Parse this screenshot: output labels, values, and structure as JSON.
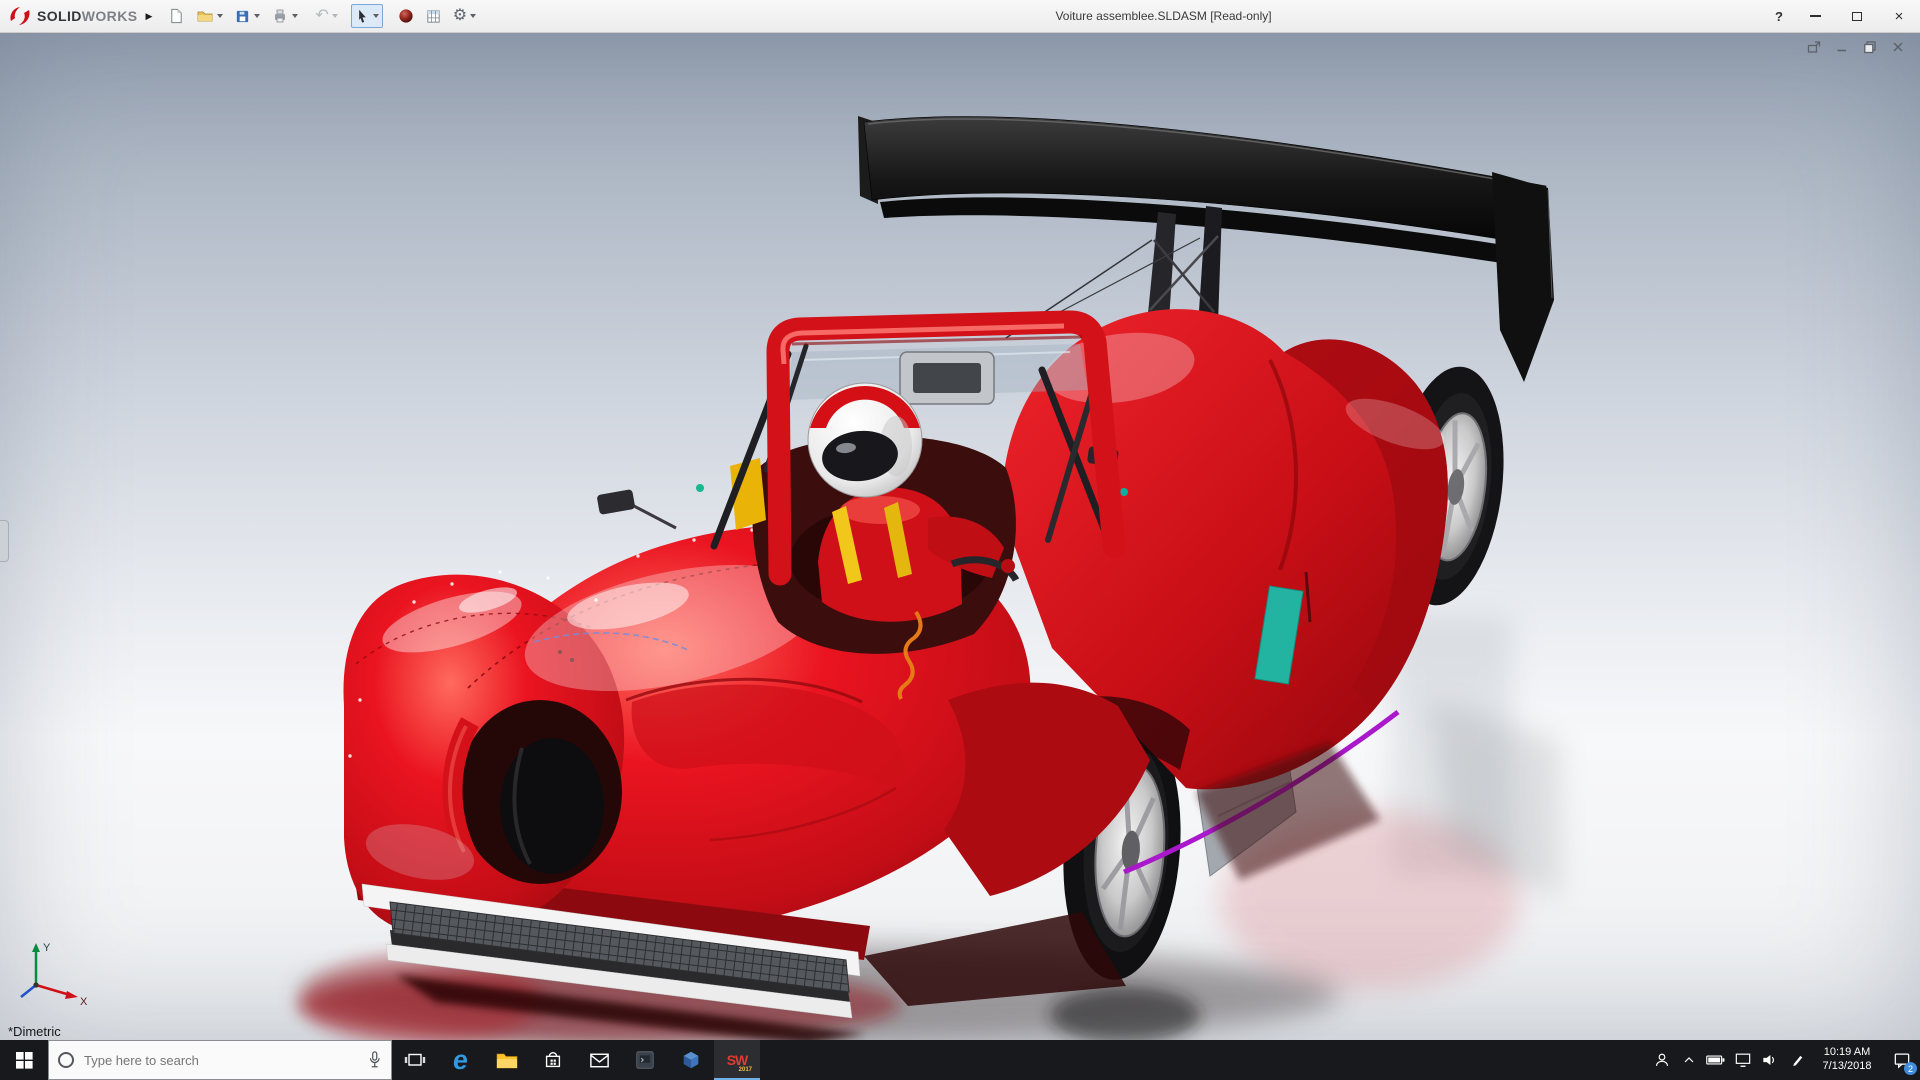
{
  "colors": {
    "car_red": "#e01018",
    "car_red_dark": "#8d070c",
    "wing_black": "#141414",
    "helmet_red": "#d40f16",
    "accent_purple": "#aa18cc",
    "accent_teal": "#17c2ae",
    "accent_yellow": "#f2c71b",
    "titlebar_bg": "#f0f0f0",
    "taskbar_bg": "#17191d",
    "viewport_gradient_top": "#97a2b3",
    "viewport_gradient_bottom": "#e9ebee"
  },
  "titlebar": {
    "brand_bold": "SOLID",
    "brand_light": "WORKS",
    "title": "Voiture assemblee.SLDASM [Read-only]",
    "expand_glyph": "▶",
    "help_glyph": "?",
    "tools": [
      "new-document",
      "open",
      "save",
      "print",
      "undo",
      "select",
      "appearance",
      "design-table",
      "options"
    ]
  },
  "toolbar_glyphs": {
    "undo": "↶",
    "gear": "⚙"
  },
  "doc_window": {
    "controls": [
      "float",
      "minimize",
      "restore",
      "close"
    ]
  },
  "viewport": {
    "orientation_label": "*Dimetric",
    "triad": {
      "x_label": "X",
      "y_label": "Y"
    },
    "model": "red Le Mans prototype race car with driver, black rear wing"
  },
  "taskbar": {
    "search_placeholder": "Type here to search",
    "apps": [
      "edge",
      "file-explorer",
      "store",
      "mail",
      "app-window",
      "cad-cube",
      "solidworks-2017"
    ],
    "edge_glyph": "e",
    "sw_label": "SW",
    "sw_year": "2017",
    "tray": {
      "icons": [
        "people",
        "hidden-icons-chevron",
        "battery",
        "network",
        "volume",
        "pen",
        "clock",
        "action-center"
      ],
      "time": "10:19 AM",
      "date": "7/13/2018",
      "notification_badge": "2"
    }
  }
}
